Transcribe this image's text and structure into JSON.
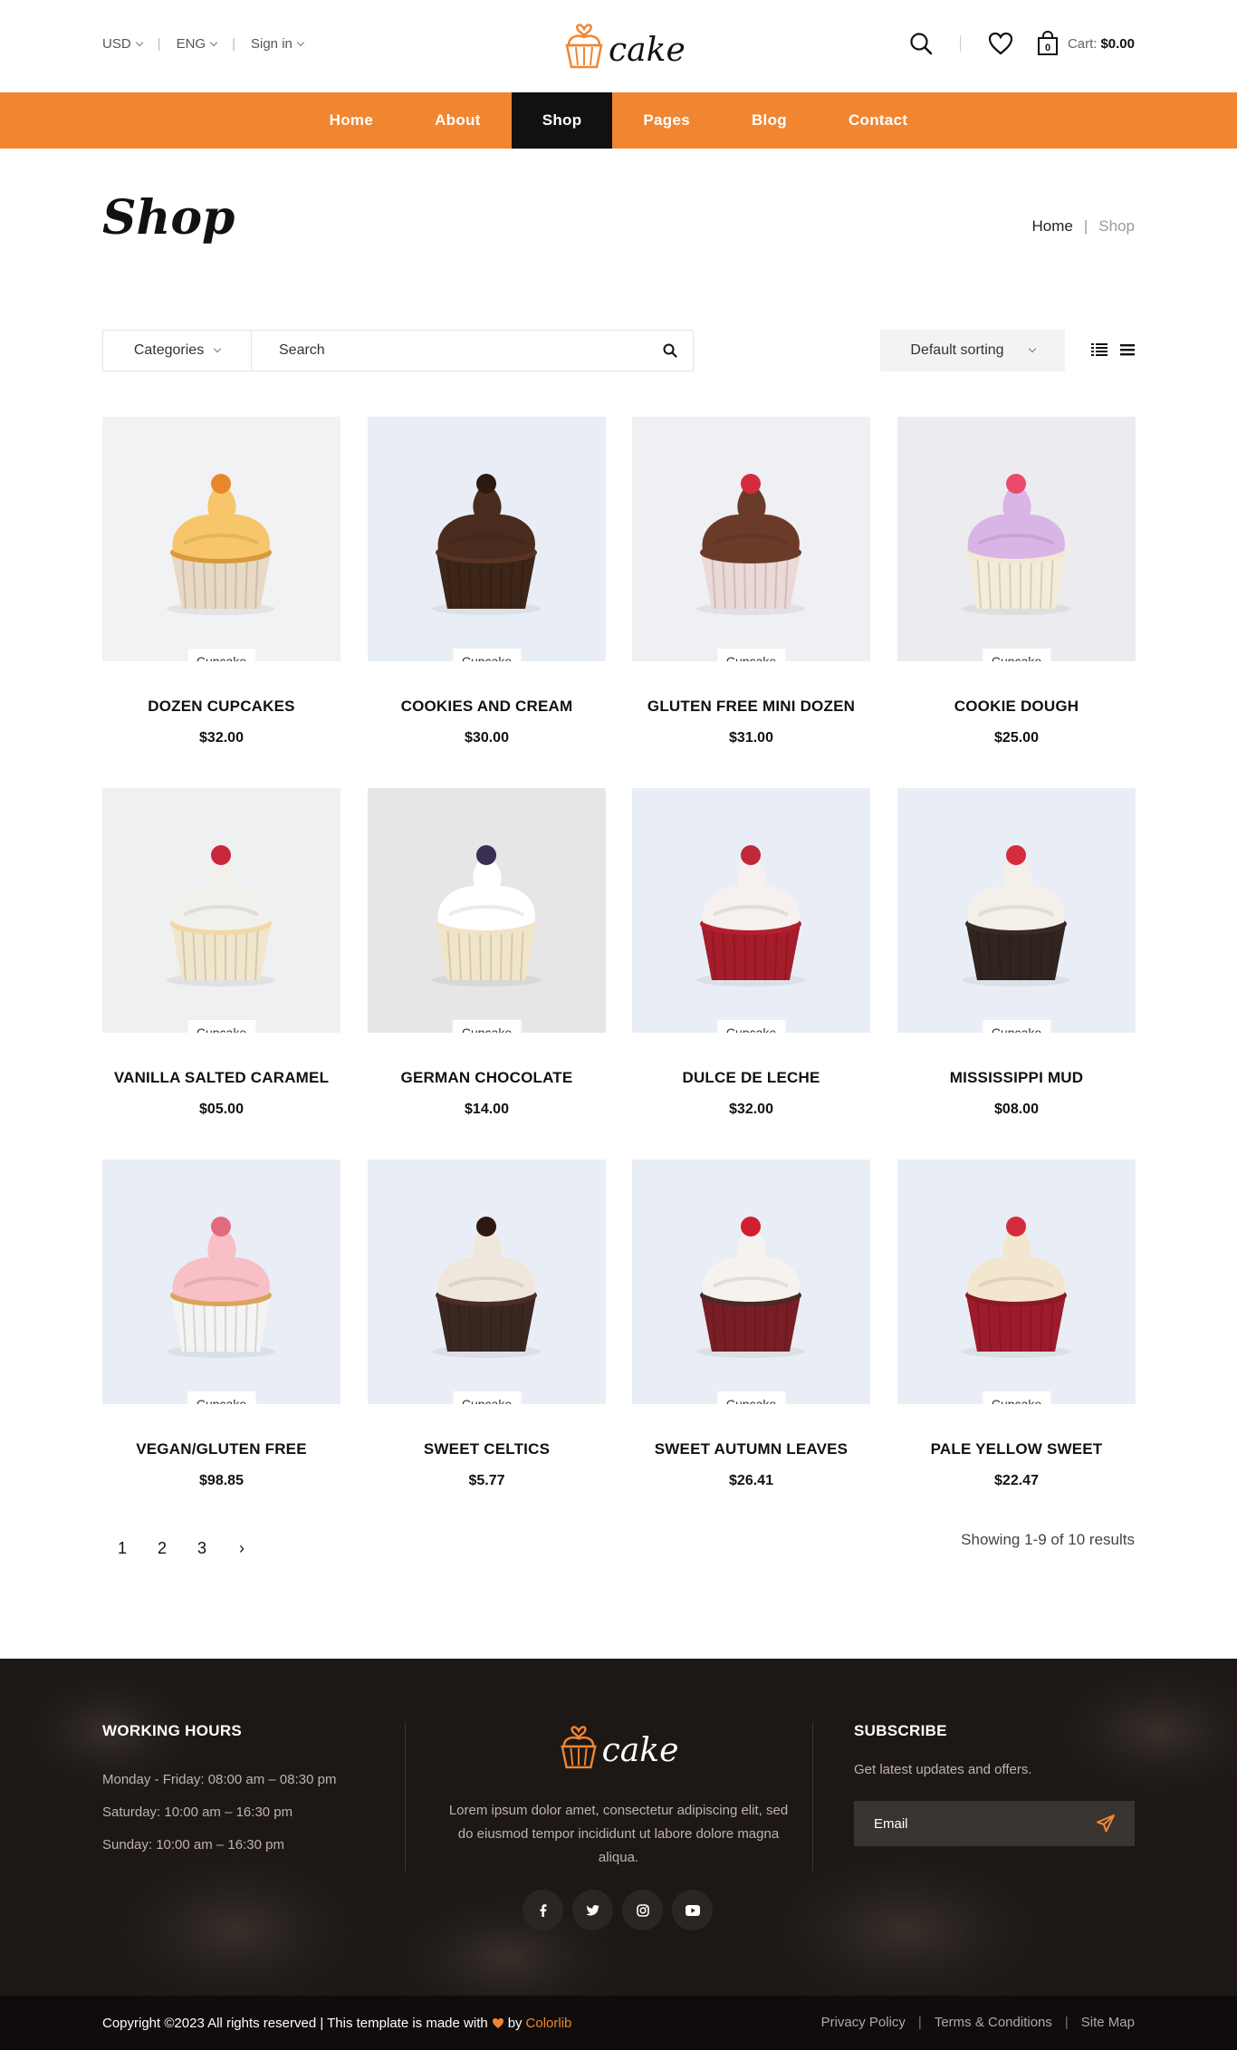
{
  "topbar": {
    "currency": "USD",
    "language": "ENG",
    "signin": "Sign in",
    "logo_text": "cake",
    "cart_label": "Cart:",
    "cart_total": "$0.00",
    "cart_count": "0"
  },
  "nav": {
    "items": [
      {
        "label": "Home"
      },
      {
        "label": "About"
      },
      {
        "label": "Shop"
      },
      {
        "label": "Pages"
      },
      {
        "label": "Blog"
      },
      {
        "label": "Contact"
      }
    ]
  },
  "header": {
    "title": "Shop",
    "breadcrumb_home": "Home",
    "breadcrumb_sep": "|",
    "breadcrumb_current": "Shop"
  },
  "filters": {
    "categories_label": "Categories",
    "search_placeholder": "Search",
    "sort_label": "Default sorting"
  },
  "products": [
    {
      "name": "DOZEN CUPCAKES",
      "price": "$32.00",
      "tag": "Cupcake"
    },
    {
      "name": "COOKIES AND CREAM",
      "price": "$30.00",
      "tag": "Cupcake"
    },
    {
      "name": "GLUTEN FREE MINI DOZEN",
      "price": "$31.00",
      "tag": "Cupcake"
    },
    {
      "name": "COOKIE DOUGH",
      "price": "$25.00",
      "tag": "Cupcake"
    },
    {
      "name": "VANILLA SALTED CARAMEL",
      "price": "$05.00",
      "tag": "Cupcake"
    },
    {
      "name": "GERMAN CHOCOLATE",
      "price": "$14.00",
      "tag": "Cupcake"
    },
    {
      "name": "DULCE DE LECHE",
      "price": "$32.00",
      "tag": "Cupcake"
    },
    {
      "name": "MISSISSIPPI MUD",
      "price": "$08.00",
      "tag": "Cupcake"
    },
    {
      "name": "VEGAN/GLUTEN FREE",
      "price": "$98.85",
      "tag": "Cupcake"
    },
    {
      "name": "SWEET CELTICS",
      "price": "$5.77",
      "tag": "Cupcake"
    },
    {
      "name": "SWEET AUTUMN LEAVES",
      "price": "$26.41",
      "tag": "Cupcake"
    },
    {
      "name": "PALE YELLOW SWEET",
      "price": "$22.47",
      "tag": "Cupcake"
    }
  ],
  "pagination": {
    "pages": [
      "1",
      "2",
      "3"
    ],
    "next": "›",
    "showing": "Showing 1-9 of 10 results"
  },
  "footer": {
    "hours_title": "WORKING HOURS",
    "hours": [
      "Monday - Friday: 08:00 am – 08:30 pm",
      "Saturday: 10:00 am – 16:30 pm",
      "Sunday: 10:00 am – 16:30 pm"
    ],
    "logo_text": "cake",
    "about": "Lorem ipsum dolor amet, consectetur adipiscing elit, sed do eiusmod tempor incididunt ut labore dolore magna aliqua.",
    "subscribe_title": "SUBSCRIBE",
    "subscribe_text": "Get latest updates and offers.",
    "email_placeholder": "Email",
    "copyright_prefix": "Copyright ©2023 All rights reserved | This template is made with",
    "copyright_by": "by",
    "colorlib": "Colorlib",
    "links": [
      "Privacy Policy",
      "Terms & Conditions",
      "Site Map"
    ],
    "link_sep": "|"
  },
  "colors": {
    "accent": "#f08632",
    "nav_active": "#111111",
    "footer_bg": "#1d1815"
  }
}
